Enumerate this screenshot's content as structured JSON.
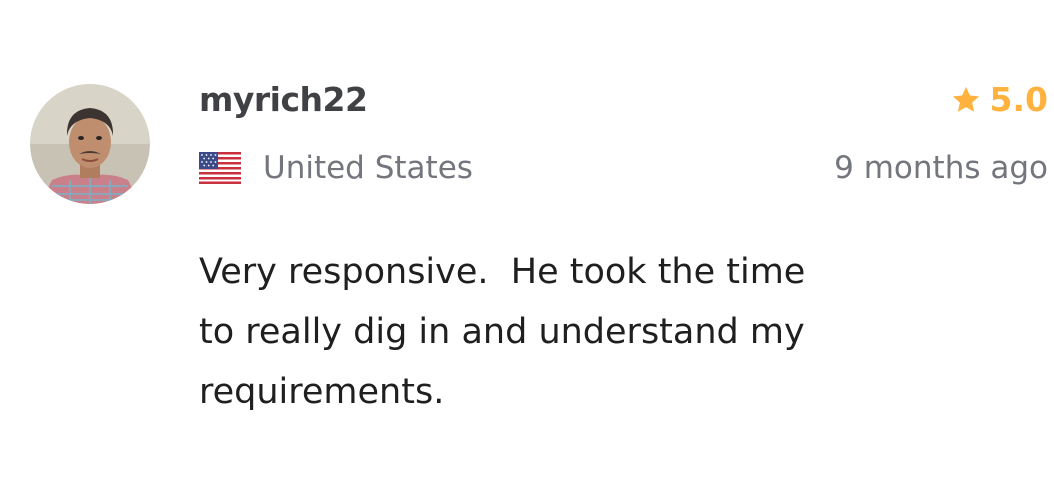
{
  "review": {
    "username": "myrich22",
    "rating": "5.0",
    "country": "United States",
    "time_ago": "9 months ago",
    "text": "Very responsive.  He took the time\nto really dig in and understand my\nrequirements.",
    "icons": {
      "rating": "star-icon",
      "country": "us-flag-icon",
      "avatar": "user-avatar-photo"
    }
  },
  "colors": {
    "star": "#ffb33e",
    "username": "#404145",
    "muted": "#74767e",
    "text": "#1f1f1f"
  }
}
